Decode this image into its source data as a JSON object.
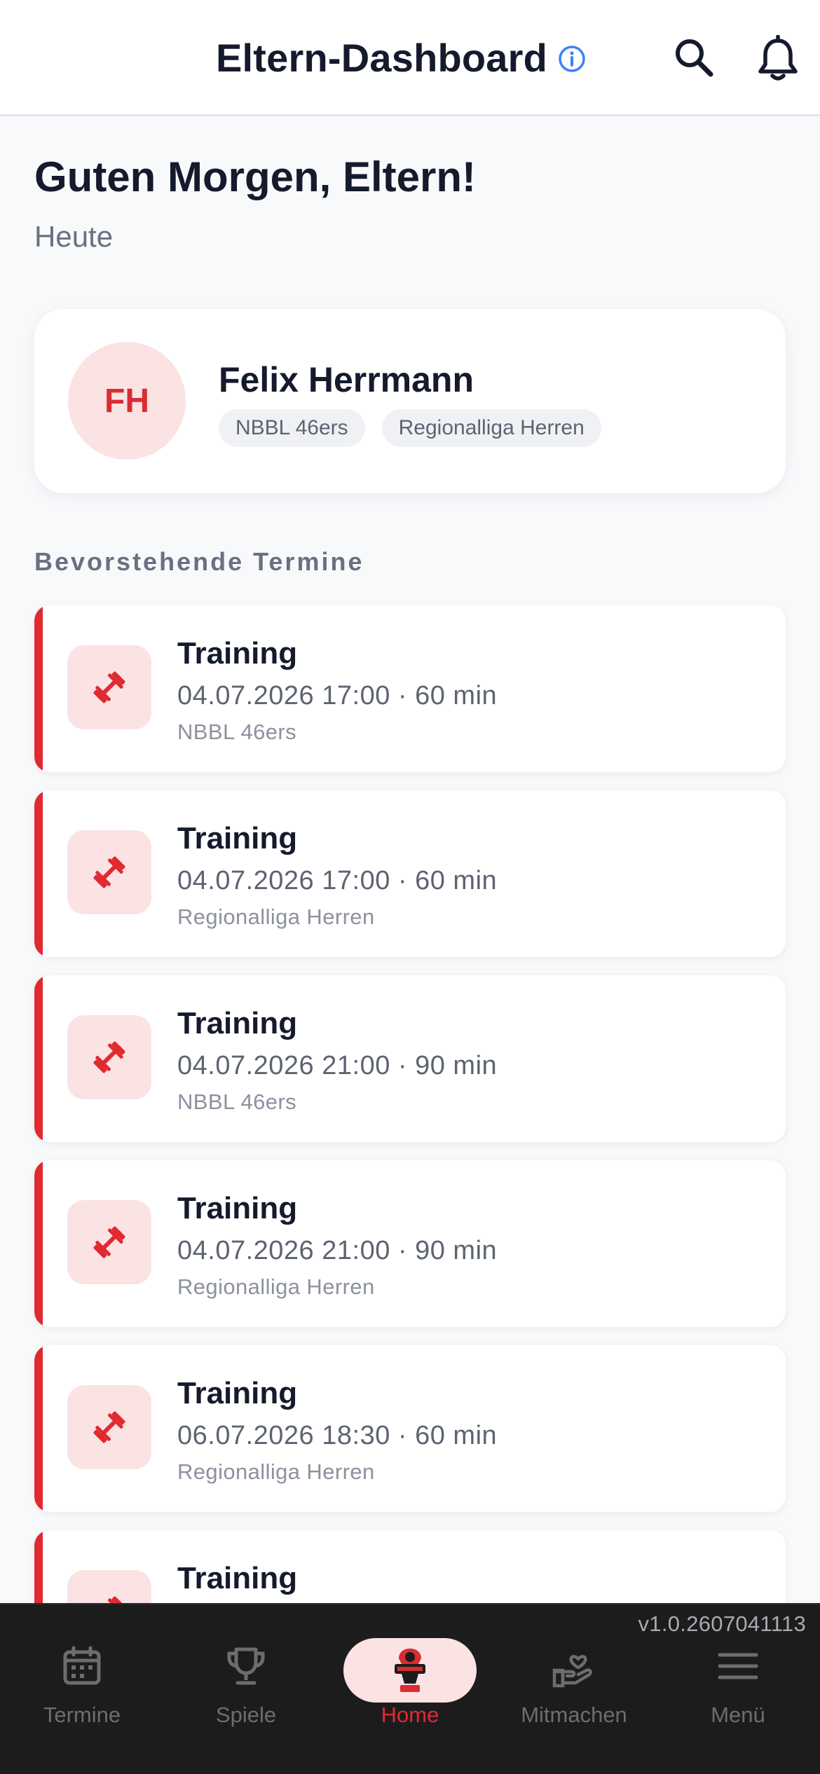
{
  "header": {
    "title": "Eltern-Dashboard",
    "icons": [
      "info-icon",
      "search-icon",
      "bell-icon"
    ]
  },
  "greeting": {
    "title": "Guten Morgen, Eltern!",
    "subtitle": "Heute"
  },
  "profile": {
    "initials": "FH",
    "name": "Felix Herrmann",
    "teams": [
      "NBBL 46ers",
      "Regionalliga Herren"
    ]
  },
  "events_section": {
    "title": "Bevorstehende Termine"
  },
  "events": [
    {
      "title": "Training",
      "meta": "04.07.2026 17:00 · 60 min",
      "team": "NBBL 46ers"
    },
    {
      "title": "Training",
      "meta": "04.07.2026 17:00 · 60 min",
      "team": "Regionalliga Herren"
    },
    {
      "title": "Training",
      "meta": "04.07.2026 21:00 · 90 min",
      "team": "NBBL 46ers"
    },
    {
      "title": "Training",
      "meta": "04.07.2026 21:00 · 90 min",
      "team": "Regionalliga Herren"
    },
    {
      "title": "Training",
      "meta": "06.07.2026 18:30 · 60 min",
      "team": "Regionalliga Herren"
    },
    {
      "title": "Training",
      "meta": "",
      "team": ""
    }
  ],
  "nav": {
    "version": "v1.0.2607041113",
    "items": [
      {
        "label": "Termine",
        "icon": "calendar-icon"
      },
      {
        "label": "Spiele",
        "icon": "trophy-icon"
      },
      {
        "label": "Home",
        "icon": "team-logo-icon",
        "active": true
      },
      {
        "label": "Mitmachen",
        "icon": "hand-heart-icon"
      },
      {
        "label": "Menü",
        "icon": "menu-icon"
      }
    ]
  },
  "colors": {
    "accent": "#e02a30",
    "accent_soft": "#fbe2e3",
    "info_blue": "#3b82f6",
    "nav_bg": "#1c1c1d"
  }
}
